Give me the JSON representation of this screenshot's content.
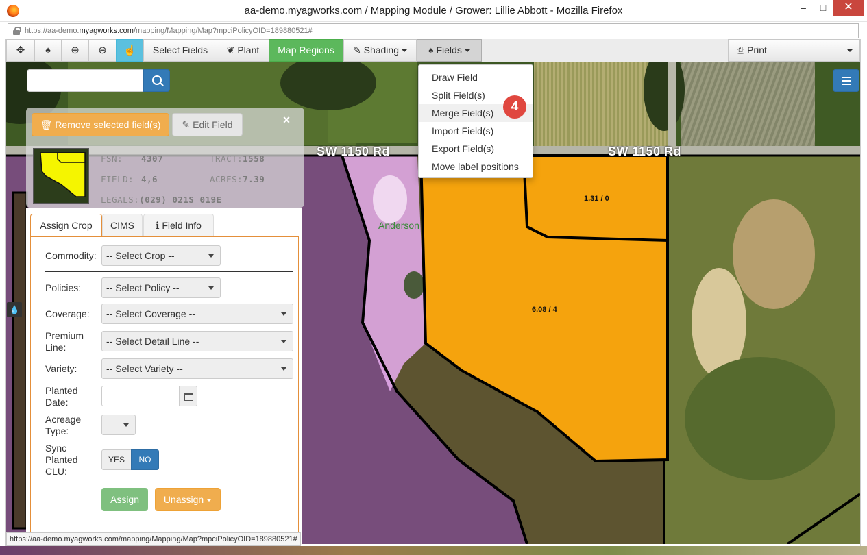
{
  "window": {
    "title": "aa-demo.myagworks.com / Mapping Module / Grower: Lillie Abbott - Mozilla Firefox",
    "min": "–",
    "max": "□",
    "close": "✕"
  },
  "address": {
    "prefix": "https://aa-demo.",
    "domain": "myagworks.com",
    "path": "/mapping/Mapping/Map?mpciPolicyOID=189880521#"
  },
  "toolbar": {
    "select_fields": "Select Fields",
    "plant": "Plant",
    "map_regions": "Map Regions",
    "shading": "Shading",
    "fields": "Fields",
    "print": "Print",
    "icons": [
      "move-icon",
      "pin-icon",
      "zoom-in-icon",
      "zoom-out-icon",
      "hand-pointer-icon"
    ]
  },
  "fields_menu": {
    "items": [
      "Draw Field",
      "Split Field(s)",
      "Merge Field(s)",
      "Import Field(s)",
      "Export Field(s)",
      "Move label positions"
    ],
    "highlighted": "Merge Field(s)",
    "step_badge": "4"
  },
  "search": {
    "value": "",
    "placeholder": ""
  },
  "selected_field": {
    "remove_btn": "Remove selected field(s)",
    "edit_btn": "Edit Field",
    "close": "×",
    "fsn_label": "FSN:",
    "fsn": "4307",
    "tract_label": "TRACT:",
    "tract": "1558",
    "field_label": "FIELD:",
    "field": "4,6",
    "acres_label": "ACRES:",
    "acres": "7.39",
    "legals_label": "LEGALS:",
    "legals": "(029) 021S 019E"
  },
  "tabs": [
    "Assign Crop",
    "CIMS",
    "Field Info"
  ],
  "form": {
    "commodity_label": "Commodity:",
    "commodity": "-- Select Crop --",
    "policies_label": "Policies:",
    "policies": "-- Select Policy --",
    "coverage_label": "Coverage:",
    "coverage": "-- Select Coverage --",
    "premium_label_1": "Premium",
    "premium_label_2": "Line:",
    "premium": "-- Select Detail Line --",
    "variety_label": "Variety:",
    "variety": "-- Select Variety --",
    "planted_label_1": "Planted",
    "planted_label_2": "Date:",
    "planted_date": "",
    "acreage_label_1": "Acreage",
    "acreage_label_2": "Type:",
    "acreage": "",
    "sync_label_1": "Sync",
    "sync_label_2": "Planted",
    "sync_label_3": "CLU:",
    "yes": "YES",
    "no": "NO",
    "sync_selected": "NO",
    "assign": "Assign",
    "unassign": "Unassign"
  },
  "map": {
    "road_1": "SW 1150 Rd",
    "road_2": "SW 1150 Rd",
    "place": "Anderson",
    "label_upper": "1.31 / 0",
    "label_main": "6.08 / 4",
    "colors": {
      "selected_field": "#f5a30d",
      "clu_purple": "#8e5aa8",
      "clu_pink": "#e7aef0"
    }
  },
  "status_url": "https://aa-demo.myagworks.com/mapping/Mapping/Map?mpciPolicyOID=189880521#"
}
